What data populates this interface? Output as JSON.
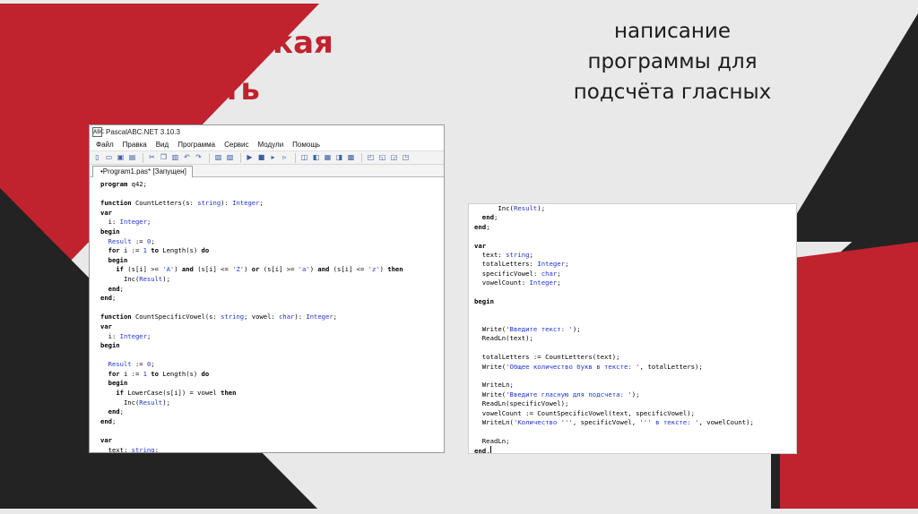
{
  "colors": {
    "accent": "#c0222e",
    "dark": "#232323",
    "background": "#e9e9e9"
  },
  "heading_left": [
    "практическая",
    "часть"
  ],
  "heading_right": [
    "написание",
    "программы для",
    "подсчёта гласных"
  ],
  "ide": {
    "window_title": "PascalABC.NET 3.10.3",
    "app_icon_text": "ABC",
    "menu": [
      "Файл",
      "Правка",
      "Вид",
      "Программа",
      "Сервис",
      "Модули",
      "Помощь"
    ],
    "toolbar_icons": [
      "new-file-icon",
      "open-icon",
      "save-icon",
      "save-all-icon",
      "cut-icon",
      "copy-icon",
      "paste-icon",
      "undo-icon",
      "redo-icon",
      "find-icon",
      "replace-icon",
      "run-icon",
      "stop-icon",
      "step-icon",
      "step-over-icon",
      "breakpoint-icon",
      "watch-icon",
      "format-icon",
      "debug-icon",
      "compile-icon",
      "toggle-panel-icon",
      "window-icon",
      "window2-icon",
      "window3-icon"
    ],
    "tab_label": "•Program1.pas* [Запущен]",
    "code": [
      [
        [
          "kw",
          "program"
        ],
        [
          "nm",
          " q42;"
        ]
      ],
      [],
      [
        [
          "kw",
          "function"
        ],
        [
          "nm",
          " CountLetters(s: "
        ],
        [
          "ty",
          "string"
        ],
        [
          "nm",
          "): "
        ],
        [
          "ty",
          "Integer"
        ],
        [
          "nm",
          ";"
        ]
      ],
      [
        [
          "kw",
          "var"
        ]
      ],
      [
        [
          "nm",
          "  i: "
        ],
        [
          "ty",
          "Integer"
        ],
        [
          "nm",
          ";"
        ]
      ],
      [
        [
          "kw",
          "begin"
        ]
      ],
      [
        [
          "nm",
          "  "
        ],
        [
          "ty",
          "Result"
        ],
        [
          "nm",
          " := "
        ],
        [
          "st",
          "0"
        ],
        [
          "nm",
          ";"
        ]
      ],
      [
        [
          "nm",
          "  "
        ],
        [
          "kw",
          "for"
        ],
        [
          "nm",
          " i := "
        ],
        [
          "st",
          "1"
        ],
        [
          "nm",
          " "
        ],
        [
          "kw",
          "to"
        ],
        [
          "nm",
          " Length(s) "
        ],
        [
          "kw",
          "do"
        ]
      ],
      [
        [
          "nm",
          "  "
        ],
        [
          "kw",
          "begin"
        ]
      ],
      [
        [
          "nm",
          "    "
        ],
        [
          "kw",
          "if"
        ],
        [
          "nm",
          " (s[i] >= "
        ],
        [
          "st",
          "'A'"
        ],
        [
          "nm",
          ") "
        ],
        [
          "kw",
          "and"
        ],
        [
          "nm",
          " (s[i] <= "
        ],
        [
          "st",
          "'Z'"
        ],
        [
          "nm",
          ") "
        ],
        [
          "kw",
          "or"
        ],
        [
          "nm",
          " (s[i] >= "
        ],
        [
          "st",
          "'a'"
        ],
        [
          "nm",
          ") "
        ],
        [
          "kw",
          "and"
        ],
        [
          "nm",
          " (s[i] <= "
        ],
        [
          "st",
          "'z'"
        ],
        [
          "nm",
          ") "
        ],
        [
          "kw",
          "then"
        ]
      ],
      [
        [
          "nm",
          "      Inc("
        ],
        [
          "ty",
          "Result"
        ],
        [
          "nm",
          ");"
        ]
      ],
      [
        [
          "nm",
          "  "
        ],
        [
          "kw",
          "end"
        ],
        [
          "nm",
          ";"
        ]
      ],
      [
        [
          "kw",
          "end"
        ],
        [
          "nm",
          ";"
        ]
      ],
      [],
      [
        [
          "kw",
          "function"
        ],
        [
          "nm",
          " CountSpecificVowel(s: "
        ],
        [
          "ty",
          "string"
        ],
        [
          "nm",
          "; vowel: "
        ],
        [
          "ty",
          "char"
        ],
        [
          "nm",
          "): "
        ],
        [
          "ty",
          "Integer"
        ],
        [
          "nm",
          ";"
        ]
      ],
      [
        [
          "kw",
          "var"
        ]
      ],
      [
        [
          "nm",
          "  i: "
        ],
        [
          "ty",
          "Integer"
        ],
        [
          "nm",
          ";"
        ]
      ],
      [
        [
          "kw",
          "begin"
        ]
      ],
      [],
      [
        [
          "nm",
          "  "
        ],
        [
          "ty",
          "Result"
        ],
        [
          "nm",
          " := "
        ],
        [
          "st",
          "0"
        ],
        [
          "nm",
          ";"
        ]
      ],
      [
        [
          "nm",
          "  "
        ],
        [
          "kw",
          "for"
        ],
        [
          "nm",
          " i := "
        ],
        [
          "st",
          "1"
        ],
        [
          "nm",
          " "
        ],
        [
          "kw",
          "to"
        ],
        [
          "nm",
          " Length(s) "
        ],
        [
          "kw",
          "do"
        ]
      ],
      [
        [
          "nm",
          "  "
        ],
        [
          "kw",
          "begin"
        ]
      ],
      [
        [
          "nm",
          "    "
        ],
        [
          "kw",
          "if"
        ],
        [
          "nm",
          " LowerCase(s[i]) = vowel "
        ],
        [
          "kw",
          "then"
        ]
      ],
      [
        [
          "nm",
          "      Inc("
        ],
        [
          "ty",
          "Result"
        ],
        [
          "nm",
          ");"
        ]
      ],
      [
        [
          "nm",
          "  "
        ],
        [
          "kw",
          "end"
        ],
        [
          "nm",
          ";"
        ]
      ],
      [
        [
          "kw",
          "end"
        ],
        [
          "nm",
          ";"
        ]
      ],
      [],
      [
        [
          "kw",
          "var"
        ]
      ],
      [
        [
          "nm",
          "  text: "
        ],
        [
          "ty",
          "string"
        ],
        [
          "nm",
          ";"
        ]
      ]
    ]
  },
  "panel2": {
    "code": [
      [
        [
          "nm",
          "      Inc("
        ],
        [
          "ty",
          "Result"
        ],
        [
          "nm",
          ");"
        ]
      ],
      [
        [
          "nm",
          "  "
        ],
        [
          "kw",
          "end"
        ],
        [
          "nm",
          ";"
        ]
      ],
      [
        [
          "kw",
          "end"
        ],
        [
          "nm",
          ";"
        ]
      ],
      [],
      [
        [
          "kw",
          "var"
        ]
      ],
      [
        [
          "nm",
          "  text: "
        ],
        [
          "ty",
          "string"
        ],
        [
          "nm",
          ";"
        ]
      ],
      [
        [
          "nm",
          "  totalLetters: "
        ],
        [
          "ty",
          "Integer"
        ],
        [
          "nm",
          ";"
        ]
      ],
      [
        [
          "nm",
          "  specificVowel: "
        ],
        [
          "ty",
          "char"
        ],
        [
          "nm",
          ";"
        ]
      ],
      [
        [
          "nm",
          "  vowelCount: "
        ],
        [
          "ty",
          "Integer"
        ],
        [
          "nm",
          ";"
        ]
      ],
      [],
      [
        [
          "kw",
          "begin"
        ]
      ],
      [],
      [],
      [
        [
          "nm",
          "  Write("
        ],
        [
          "st",
          "'Введите текст: '"
        ],
        [
          "nm",
          ");"
        ]
      ],
      [
        [
          "nm",
          "  ReadLn(text);"
        ]
      ],
      [],
      [
        [
          "nm",
          "  totalLetters := CountLetters(text);"
        ]
      ],
      [
        [
          "nm",
          "  Write("
        ],
        [
          "st",
          "'Общее количество букв в тексте: '"
        ],
        [
          "nm",
          ", totalLetters);"
        ]
      ],
      [],
      [
        [
          "nm",
          "  WriteLn;"
        ]
      ],
      [
        [
          "nm",
          "  Write("
        ],
        [
          "st",
          "'Введите гласную для подсчета: '"
        ],
        [
          "nm",
          ");"
        ]
      ],
      [
        [
          "nm",
          "  ReadLn(specificVowel);"
        ]
      ],
      [
        [
          "nm",
          "  vowelCount := CountSpecificVowel(text, specificVowel);"
        ]
      ],
      [
        [
          "nm",
          "  WriteLn("
        ],
        [
          "st",
          "'Количество '''"
        ],
        [
          "nm",
          ", specificVowel, "
        ],
        [
          "st",
          "''' в тексте: '"
        ],
        [
          "nm",
          ", vowelCount);"
        ]
      ],
      [],
      [
        [
          "nm",
          "  ReadLn;"
        ]
      ],
      [
        [
          "kw",
          "end"
        ],
        [
          "nm",
          "."
        ]
      ]
    ]
  }
}
